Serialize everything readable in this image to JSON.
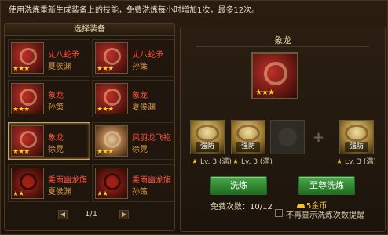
{
  "tip": "使用洗炼重新生成装备上的技能，免费洗炼每小时增加1次，最多12次。",
  "left_panel": {
    "title": "选择装备",
    "items": [
      {
        "name": "丈八蛇矛",
        "hero": "夏侯渊",
        "stars": "★★★"
      },
      {
        "name": "丈八蛇矛",
        "hero": "孙策",
        "stars": "★★★"
      },
      {
        "name": "象龙",
        "hero": "孙策",
        "stars": "★★★"
      },
      {
        "name": "象龙",
        "hero": "夏侯渊",
        "stars": "★★★"
      },
      {
        "name": "象龙",
        "hero": "徐晃",
        "stars": "★★★"
      },
      {
        "name": "凤羽龙飞袍",
        "hero": "徐晃",
        "stars": "★★★"
      },
      {
        "name": "乘雨幽龙旗",
        "hero": "夏侯渊",
        "stars": "★★"
      },
      {
        "name": "乘雨幽龙旗",
        "hero": "孙策",
        "stars": "★★"
      }
    ],
    "pager": {
      "prev": "◀",
      "next": "▶",
      "text": "1/1"
    }
  },
  "right_panel": {
    "title": "象龙",
    "big_stars": "★★★",
    "skills": [
      {
        "label": "强防",
        "lv": "Lv. 3 (满)"
      },
      {
        "label": "强防",
        "lv": "Lv. 3 (满)"
      },
      {
        "label": "",
        "lv": ""
      },
      {
        "label": "强防",
        "lv": "Lv. 3 (满)"
      }
    ],
    "plus": "+",
    "star_symbol": "★",
    "btn_refine": "洗炼",
    "btn_supreme": "至尊洗炼",
    "free_text": "免费次数：10/12",
    "gold_text": "5金币",
    "checkbox_label": "不再显示洗炼次数提醒"
  }
}
